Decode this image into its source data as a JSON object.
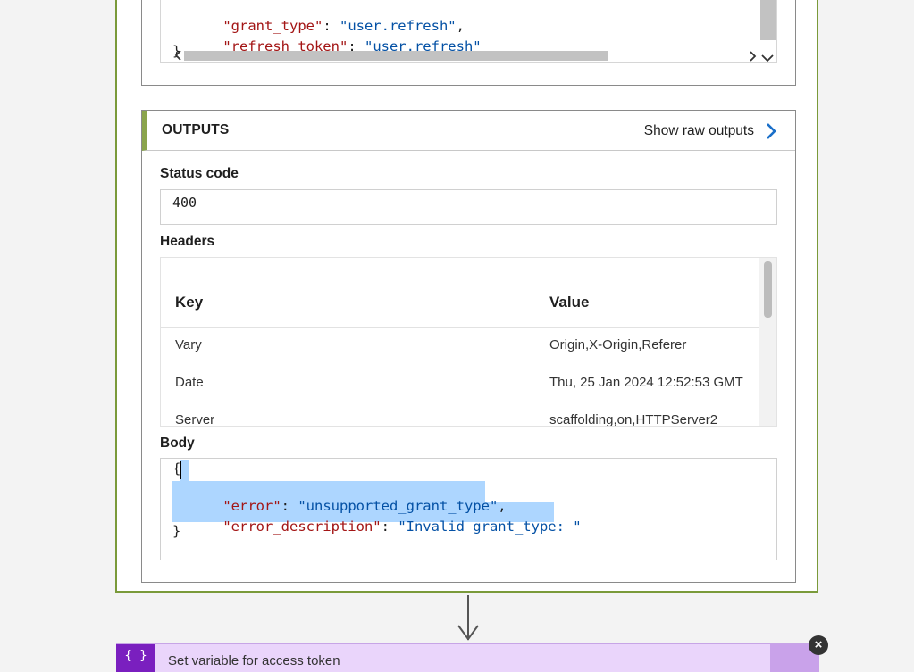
{
  "inputs": {
    "code_lines": [
      {
        "key": "\"grant_type\"",
        "sep": ": ",
        "val": "\"user.refresh\"",
        "tail": ","
      },
      {
        "key": "\"refresh_token\"",
        "sep": ": ",
        "val": "\"user.refresh\"",
        "tail": ""
      }
    ],
    "closing_brace": "}"
  },
  "outputs": {
    "title": "OUTPUTS",
    "show_raw_label": "Show raw outputs",
    "status_code_label": "Status code",
    "status_code_value": "400",
    "headers_label": "Headers",
    "headers_columns": [
      "Key",
      "Value"
    ],
    "headers_rows": [
      {
        "key": "Vary",
        "value": "Origin,X-Origin,Referer"
      },
      {
        "key": "Date",
        "value": "Thu, 25 Jan 2024 12:52:53 GMT"
      },
      {
        "key": "Server",
        "value": "scaffolding,on,HTTPServer2"
      }
    ],
    "body_label": "Body",
    "body_open": "{",
    "body_lines": [
      {
        "key": "\"error\"",
        "sep": ": ",
        "val": "\"unsupported_grant_type\"",
        "tail": ","
      },
      {
        "key": "\"error_description\"",
        "sep": ": ",
        "val": "\"Invalid grant_type: \"",
        "tail": ""
      }
    ],
    "body_close": "}"
  },
  "next_action": {
    "icon": "{ }",
    "title": "Set variable for access token"
  },
  "icons": {
    "raw_outputs": "chevron-right-icon",
    "close": "close-icon",
    "arrow": "arrow-down-icon"
  },
  "colors": {
    "card_border": "#7a9a3a",
    "outputs_accent": "#8aa44c",
    "json_key": "#a31515",
    "json_string": "#0451a5",
    "selection": "#add6ff",
    "next_action_icon_bg": "#7a1fbf",
    "next_action_bg": "#ead5fb"
  }
}
